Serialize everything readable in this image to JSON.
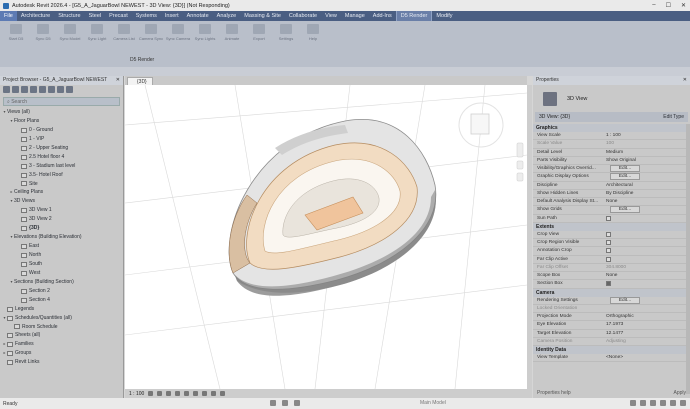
{
  "window": {
    "title": "Autodesk Revit 2026.4 - [G5_A_JaguarBowl NEWEST - 3D View: {3D}] (Not Responding)",
    "controls": [
      "–",
      "☐",
      "✕"
    ]
  },
  "ribbon": {
    "tabs": [
      "File",
      "Architecture",
      "Structure",
      "Steel",
      "Precast",
      "Systems",
      "Insert",
      "Annotate",
      "Analyze",
      "Massing & Site",
      "Collaborate",
      "View",
      "Manage",
      "Add-Ins",
      "D5 Render",
      "Modify"
    ],
    "active_tab": "File",
    "current_tab": "D5 Render",
    "tools": [
      "Start D5",
      "Sync D5",
      "Sync Model",
      "Sync Light",
      "Camera List",
      "Camera Sync",
      "Sync Camera",
      "Sync Lights",
      "Animate",
      "Export",
      "Settings",
      "Help"
    ],
    "panel_label": "D5 Render"
  },
  "project_browser": {
    "title": "Project Browser - G5_A_JaguarBowl NEWEST",
    "search_placeholder": "Search",
    "tree": [
      {
        "label": "Views (all)",
        "level": 0,
        "exp": "▾",
        "icon": false
      },
      {
        "label": "Floor Plans",
        "level": 1,
        "exp": "▾",
        "icon": false
      },
      {
        "label": "0 - Ground",
        "level": 2,
        "exp": "",
        "icon": true
      },
      {
        "label": "1 - VIP",
        "level": 2,
        "exp": "",
        "icon": true
      },
      {
        "label": "2 - Upper Seating",
        "level": 2,
        "exp": "",
        "icon": true
      },
      {
        "label": "2.5 Hotel floor 4",
        "level": 2,
        "exp": "",
        "icon": true
      },
      {
        "label": "3 - Stadium last level",
        "level": 2,
        "exp": "",
        "icon": true
      },
      {
        "label": "3.5- Hotel Roof",
        "level": 2,
        "exp": "",
        "icon": true
      },
      {
        "label": "Site",
        "level": 2,
        "exp": "",
        "icon": true
      },
      {
        "label": "Ceiling Plans",
        "level": 1,
        "exp": "▸",
        "icon": false
      },
      {
        "label": "3D Views",
        "level": 1,
        "exp": "▾",
        "icon": false
      },
      {
        "label": "3D View 1",
        "level": 2,
        "exp": "",
        "icon": true
      },
      {
        "label": "3D View 2",
        "level": 2,
        "exp": "",
        "icon": true
      },
      {
        "label": "{3D}",
        "level": 2,
        "exp": "",
        "icon": true,
        "bold": true
      },
      {
        "label": "Elevations (Building Elevation)",
        "level": 1,
        "exp": "▾",
        "icon": false
      },
      {
        "label": "East",
        "level": 2,
        "exp": "",
        "icon": true
      },
      {
        "label": "North",
        "level": 2,
        "exp": "",
        "icon": true
      },
      {
        "label": "South",
        "level": 2,
        "exp": "",
        "icon": true
      },
      {
        "label": "West",
        "level": 2,
        "exp": "",
        "icon": true
      },
      {
        "label": "Sections (Building Section)",
        "level": 1,
        "exp": "▾",
        "icon": false
      },
      {
        "label": "Section 2",
        "level": 2,
        "exp": "",
        "icon": true
      },
      {
        "label": "Section 4",
        "level": 2,
        "exp": "",
        "icon": true
      },
      {
        "label": "Legends",
        "level": 0,
        "exp": "",
        "icon": true
      },
      {
        "label": "Schedules/Quantities (all)",
        "level": 0,
        "exp": "▾",
        "icon": true
      },
      {
        "label": "Room Schedule",
        "level": 1,
        "exp": "",
        "icon": true
      },
      {
        "label": "Sheets (all)",
        "level": 0,
        "exp": "",
        "icon": true
      },
      {
        "label": "Families",
        "level": 0,
        "exp": "▸",
        "icon": true
      },
      {
        "label": "Groups",
        "level": 0,
        "exp": "▸",
        "icon": true
      },
      {
        "label": "Revit Links",
        "level": 0,
        "exp": "",
        "icon": true
      }
    ]
  },
  "view_tab": {
    "label": "{3D}"
  },
  "view_control": {
    "scale": "1 : 100"
  },
  "properties": {
    "title": "Properties",
    "type_name": "3D View",
    "instance_selector": "3D View: {3D}",
    "edit_type": "Edit Type",
    "groups": [
      {
        "name": "Graphics",
        "rows": [
          {
            "k": "View Scale",
            "v": "1 : 100",
            "kind": "field"
          },
          {
            "k": "Scale Value",
            "v": "100",
            "kind": "text",
            "dim": true
          },
          {
            "k": "Detail Level",
            "v": "Medium",
            "kind": "text"
          },
          {
            "k": "Parts Visibility",
            "v": "Show Original",
            "kind": "text"
          },
          {
            "k": "Visibility/Graphics Overrid...",
            "v": "Edit...",
            "kind": "btn"
          },
          {
            "k": "Graphic Display Options",
            "v": "Edit...",
            "kind": "btn"
          },
          {
            "k": "Discipline",
            "v": "Architectural",
            "kind": "text"
          },
          {
            "k": "Show Hidden Lines",
            "v": "By Discipline",
            "kind": "text"
          },
          {
            "k": "Default Analysis Display St...",
            "v": "None",
            "kind": "text"
          },
          {
            "k": "Show Grids",
            "v": "Edit...",
            "kind": "btn"
          },
          {
            "k": "Sun Path",
            "v": "",
            "kind": "chk"
          }
        ]
      },
      {
        "name": "Extents",
        "rows": [
          {
            "k": "Crop View",
            "v": "",
            "kind": "chk"
          },
          {
            "k": "Crop Region Visible",
            "v": "",
            "kind": "chk"
          },
          {
            "k": "Annotation Crop",
            "v": "",
            "kind": "chk"
          },
          {
            "k": "Far Clip Active",
            "v": "",
            "kind": "chk"
          },
          {
            "k": "Far Clip Offset",
            "v": "304.8000",
            "kind": "text",
            "dim": true
          },
          {
            "k": "Scope Box",
            "v": "None",
            "kind": "text"
          },
          {
            "k": "Section Box",
            "v": "",
            "kind": "chk",
            "on": true
          }
        ]
      },
      {
        "name": "Camera",
        "rows": [
          {
            "k": "Rendering Settings",
            "v": "Edit...",
            "kind": "btn"
          },
          {
            "k": "Locked Orientation",
            "v": "",
            "kind": "text",
            "dim": true
          },
          {
            "k": "Projection Mode",
            "v": "Orthographic",
            "kind": "text"
          },
          {
            "k": "Eye Elevation",
            "v": "17.1973",
            "kind": "text"
          },
          {
            "k": "Target Elevation",
            "v": "12.1477",
            "kind": "text"
          },
          {
            "k": "Camera Position",
            "v": "Adjusting",
            "kind": "text",
            "dim": true
          }
        ]
      },
      {
        "name": "Identity Data",
        "rows": [
          {
            "k": "View Template",
            "v": "<None>",
            "kind": "text"
          }
        ]
      }
    ],
    "help_link": "Properties help",
    "apply": "Apply"
  },
  "status": {
    "text": "Ready",
    "model": "Main Model"
  }
}
